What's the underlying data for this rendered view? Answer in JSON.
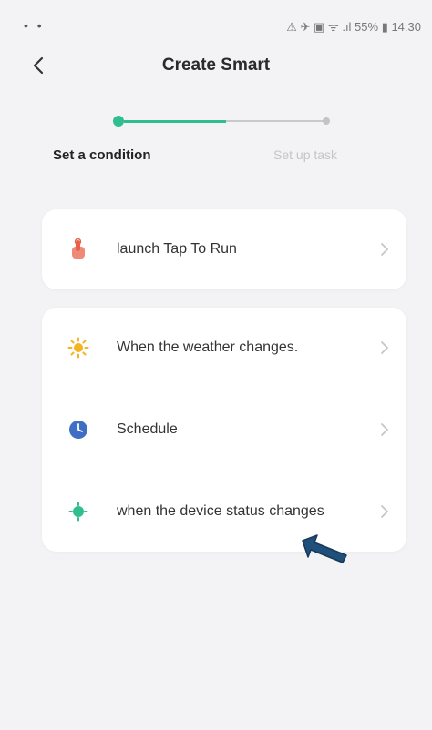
{
  "status_bar": {
    "left_icons": "• •",
    "right_text": "⚠ ✈ ▣ ᯤ .ıl 55% ▮ 14:30"
  },
  "header": {
    "title": "Create Smart",
    "back_icon": "chevron-left-icon"
  },
  "stepper": {
    "steps": [
      {
        "label": "Set a condition",
        "active": true
      },
      {
        "label": "Set up task",
        "active": false
      }
    ],
    "accent_color": "#2fbf8f",
    "inactive_color": "#c4c4c4"
  },
  "conditions": {
    "primary": [
      {
        "label": "launch Tap To Run",
        "icon": "hand-tap-icon",
        "icon_color": "#e8604c"
      }
    ],
    "secondary": [
      {
        "label": "When the weather changes.",
        "icon": "sun-icon",
        "icon_color": "#f5b323"
      },
      {
        "label": "Schedule",
        "icon": "clock-icon",
        "icon_color": "#3f6fc4"
      },
      {
        "label": "when the device status changes",
        "icon": "device-icon",
        "icon_color": "#2fbf8f"
      }
    ]
  }
}
